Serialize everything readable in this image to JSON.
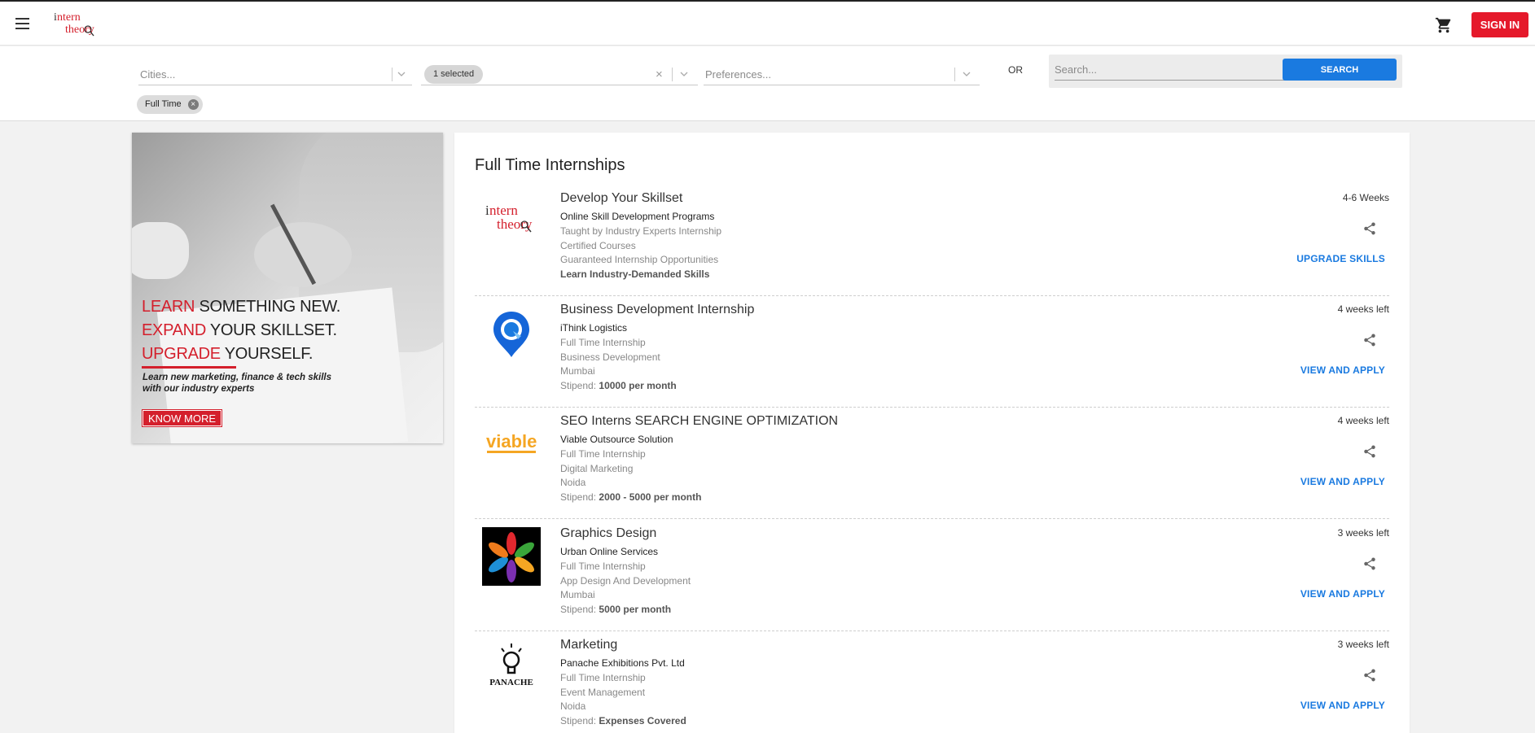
{
  "header": {
    "menu_icon": "hamburger-icon",
    "logo_alt": "intern theory",
    "cart_icon": "cart-icon",
    "signin_label": "SIGN IN",
    "colors": {
      "brand_red": "#e5192b",
      "link_blue": "#1a7ae0"
    }
  },
  "filters": {
    "cities_placeholder": "Cities...",
    "type_selected": "1 selected",
    "preferences_placeholder": "Preferences...",
    "or_label": "OR",
    "search_placeholder": "Search...",
    "search_button": "SEARCH",
    "active_chip": "Full Time"
  },
  "promo": {
    "line1_red": "LEARN",
    "line1_rest": " SOMETHING NEW.",
    "line2_red": "EXPAND",
    "line2_rest": " YOUR SKILLSET.",
    "line3_red": "UPGRADE",
    "line3_rest": " YOURSELF.",
    "subtext": "Learn new marketing, finance & tech skills with our industry experts",
    "button": "KNOW MORE"
  },
  "listing": {
    "title": "Full Time Internships",
    "items": [
      {
        "title": "Develop Your Skillset",
        "company": "Online Skill Development Programs",
        "line1": "Taught by Industry Experts Internship",
        "line2": "Certified Courses",
        "line3": "Guaranteed Internship Opportunities",
        "line4": "Learn Industry-Demanded Skills",
        "duration": "4-6 Weeks",
        "action": "UPGRADE SKILLS",
        "logo": "intern-theory-logo"
      },
      {
        "title": "Business Development Internship",
        "company": "iThink Logistics",
        "line1": "Full Time Internship",
        "line2": "Business Development",
        "line3": "Mumbai",
        "stipend_label": "Stipend:",
        "stipend": "10000 per month",
        "duration": "4 weeks left",
        "action": "VIEW AND APPLY",
        "logo": "ithink-logistics-logo"
      },
      {
        "title": "SEO Interns SEARCH ENGINE OPTIMIZATION",
        "company": "Viable Outsource Solution",
        "line1": "Full Time Internship",
        "line2": "Digital Marketing",
        "line3": "Noida",
        "stipend_label": "Stipend:",
        "stipend": "2000 - 5000 per month",
        "duration": "4 weeks left",
        "action": "VIEW AND APPLY",
        "logo": "viable-logo",
        "logo_text": "viable"
      },
      {
        "title": "Graphics Design",
        "company": "Urban Online Services",
        "line1": "Full Time Internship",
        "line2": "App Design And Development",
        "line3": "Mumbai",
        "stipend_label": "Stipend:",
        "stipend": "5000 per month",
        "duration": "3 weeks left",
        "action": "VIEW AND APPLY",
        "logo": "urban-online-logo"
      },
      {
        "title": "Marketing",
        "company": "Panache Exhibitions Pvt. Ltd",
        "line1": "Full Time Internship",
        "line2": "Event Management",
        "line3": "Noida",
        "stipend_label": "Stipend:",
        "stipend": "Expenses Covered",
        "duration": "3 weeks left",
        "action": "VIEW AND APPLY",
        "logo": "panache-logo",
        "logo_text": "PANACHE"
      }
    ]
  }
}
